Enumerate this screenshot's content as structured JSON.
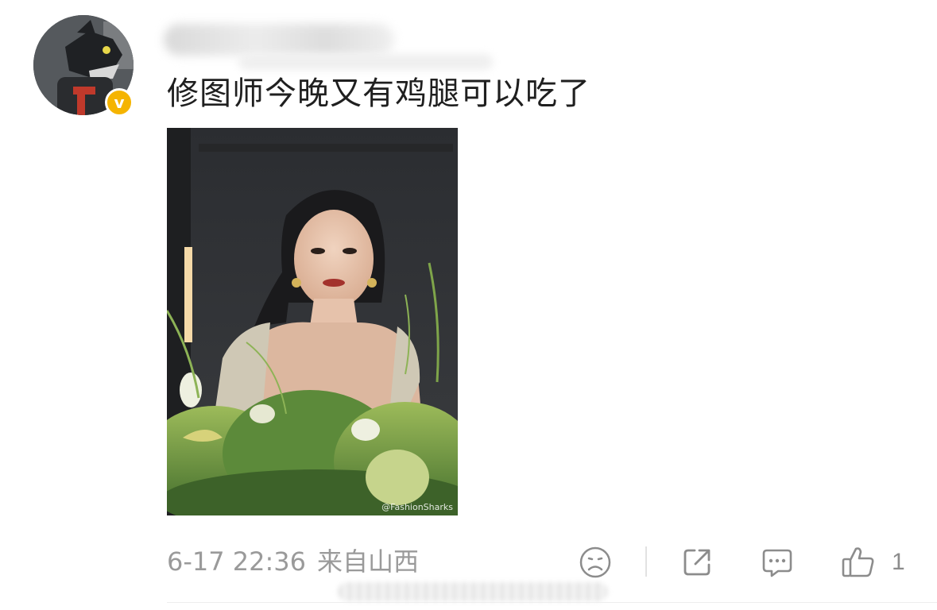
{
  "post": {
    "comment": "修图师今晚又有鸡腿可以吃了",
    "timestamp": "6-17 22:36",
    "location": "来自山西",
    "verified_badge": "v",
    "photo": {
      "watermark": "@FashionSharks"
    }
  },
  "actions": {
    "like_count": "1"
  },
  "icons": {
    "dislike": "sad-face-icon",
    "share": "share-icon",
    "comment": "comment-bubble-icon",
    "like": "thumbs-up-icon"
  },
  "colors": {
    "badge": "#f5b400",
    "meta_text": "#9a9a9a",
    "icon": "#8c8c8c"
  }
}
